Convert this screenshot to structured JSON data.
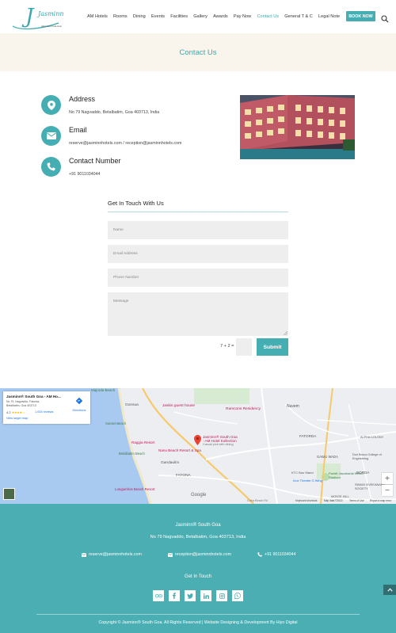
{
  "brand": {
    "logo_text": "Jasminn",
    "logo_tagline": "AM Hotel Kollection"
  },
  "nav": {
    "items": [
      "AM Hotels",
      "Rooms",
      "Dining",
      "Events",
      "Facilities",
      "Gallery",
      "Awards",
      "Pay Now",
      "Contact Us",
      "General T & C",
      "Legal Note"
    ],
    "active": "Contact Us",
    "book_now": "BOOK NOW"
  },
  "page": {
    "title": "Contact Us"
  },
  "contact": {
    "address_heading": "Address",
    "address_text": "No 79 Nagvaddo, Betalbatim, Goa 403713, India",
    "email_heading": "Email",
    "email_text": "reserve@jasminnhotels.com / reception@jasminnhotels.com",
    "phone_heading": "Contact Number",
    "phone_text": "+91 9011034044"
  },
  "form": {
    "title": "Get In Touch With Us",
    "name_placeholder": "Name",
    "email_placeholder": "Email Address",
    "phone_placeholder": "Phone Number",
    "message_placeholder": "Message",
    "captcha_question": "7 + 2 =",
    "submit_label": "Submit"
  },
  "map": {
    "card_title": "Jasminn® South Goa - AM Ho...",
    "card_address_1": "No 79, Nagvaddo, Fatorda,",
    "card_address_2": "Betalbatim, Goa 403713",
    "rating": "4.2",
    "stars": "★★★★☆",
    "reviews": "1,033 reviews",
    "larger_map": "View larger map",
    "directions": "Directions",
    "pin_label_1": "Jasminn® South Goa",
    "pin_label_2": "- AM Hotel Kollection",
    "pin_label_3": "Casual pick with dining",
    "places": [
      "Majorda Beach",
      "Gonsua",
      "Jaskin guest house",
      "Ramcons Residency",
      "Nuvem",
      "Utorda Beach",
      "Sunset Beach",
      "Raggia Resort",
      "Betalbatim Beach",
      "Nanu Beach Resort & Spa",
      "Gandaulim",
      "FATORDA",
      "GAWLI WADA",
      "Don Bosco College of Engineering",
      "ALPHA COLONY",
      "Pandit Jawaharlal Nehru Stadium",
      "KTC Bus Stand",
      "Inox Theatre G Wing",
      "BORDA",
      "FATONA",
      "Longuinhos Beach Resort",
      "SWAMI VIVEKANAND SOCIETY",
      "Colva Beach Rd",
      "MONTE HILL"
    ],
    "google": "Google",
    "keyboard": "Keyboard shortcuts",
    "mapdata": "Map data ©2022",
    "terms": "Terms of Use",
    "report": "Report a map error"
  },
  "footer": {
    "name": "Jasminn® South Goa",
    "address": "No 79 Nagvaddo, Betalbatim, Goa 403713, India",
    "email_1": "reserve@jasminnhotels.com",
    "email_2": "reception@jasminnhotels.com",
    "phone": "+91 9011034044",
    "get_in_touch": "Get In Touch",
    "social": [
      "tripadvisor-icon",
      "facebook-icon",
      "twitter-icon",
      "linkedin-icon",
      "instagram-icon",
      "whatsapp-icon"
    ],
    "copyright": "Copyright © Jasminn® South Goa. All Rights Reserved | Website Designing & Development By Hiyo Digital"
  },
  "colors": {
    "accent": "#45aeb3",
    "footer_bg": "#4aaeb2",
    "title_band": "#f9f4ec"
  }
}
